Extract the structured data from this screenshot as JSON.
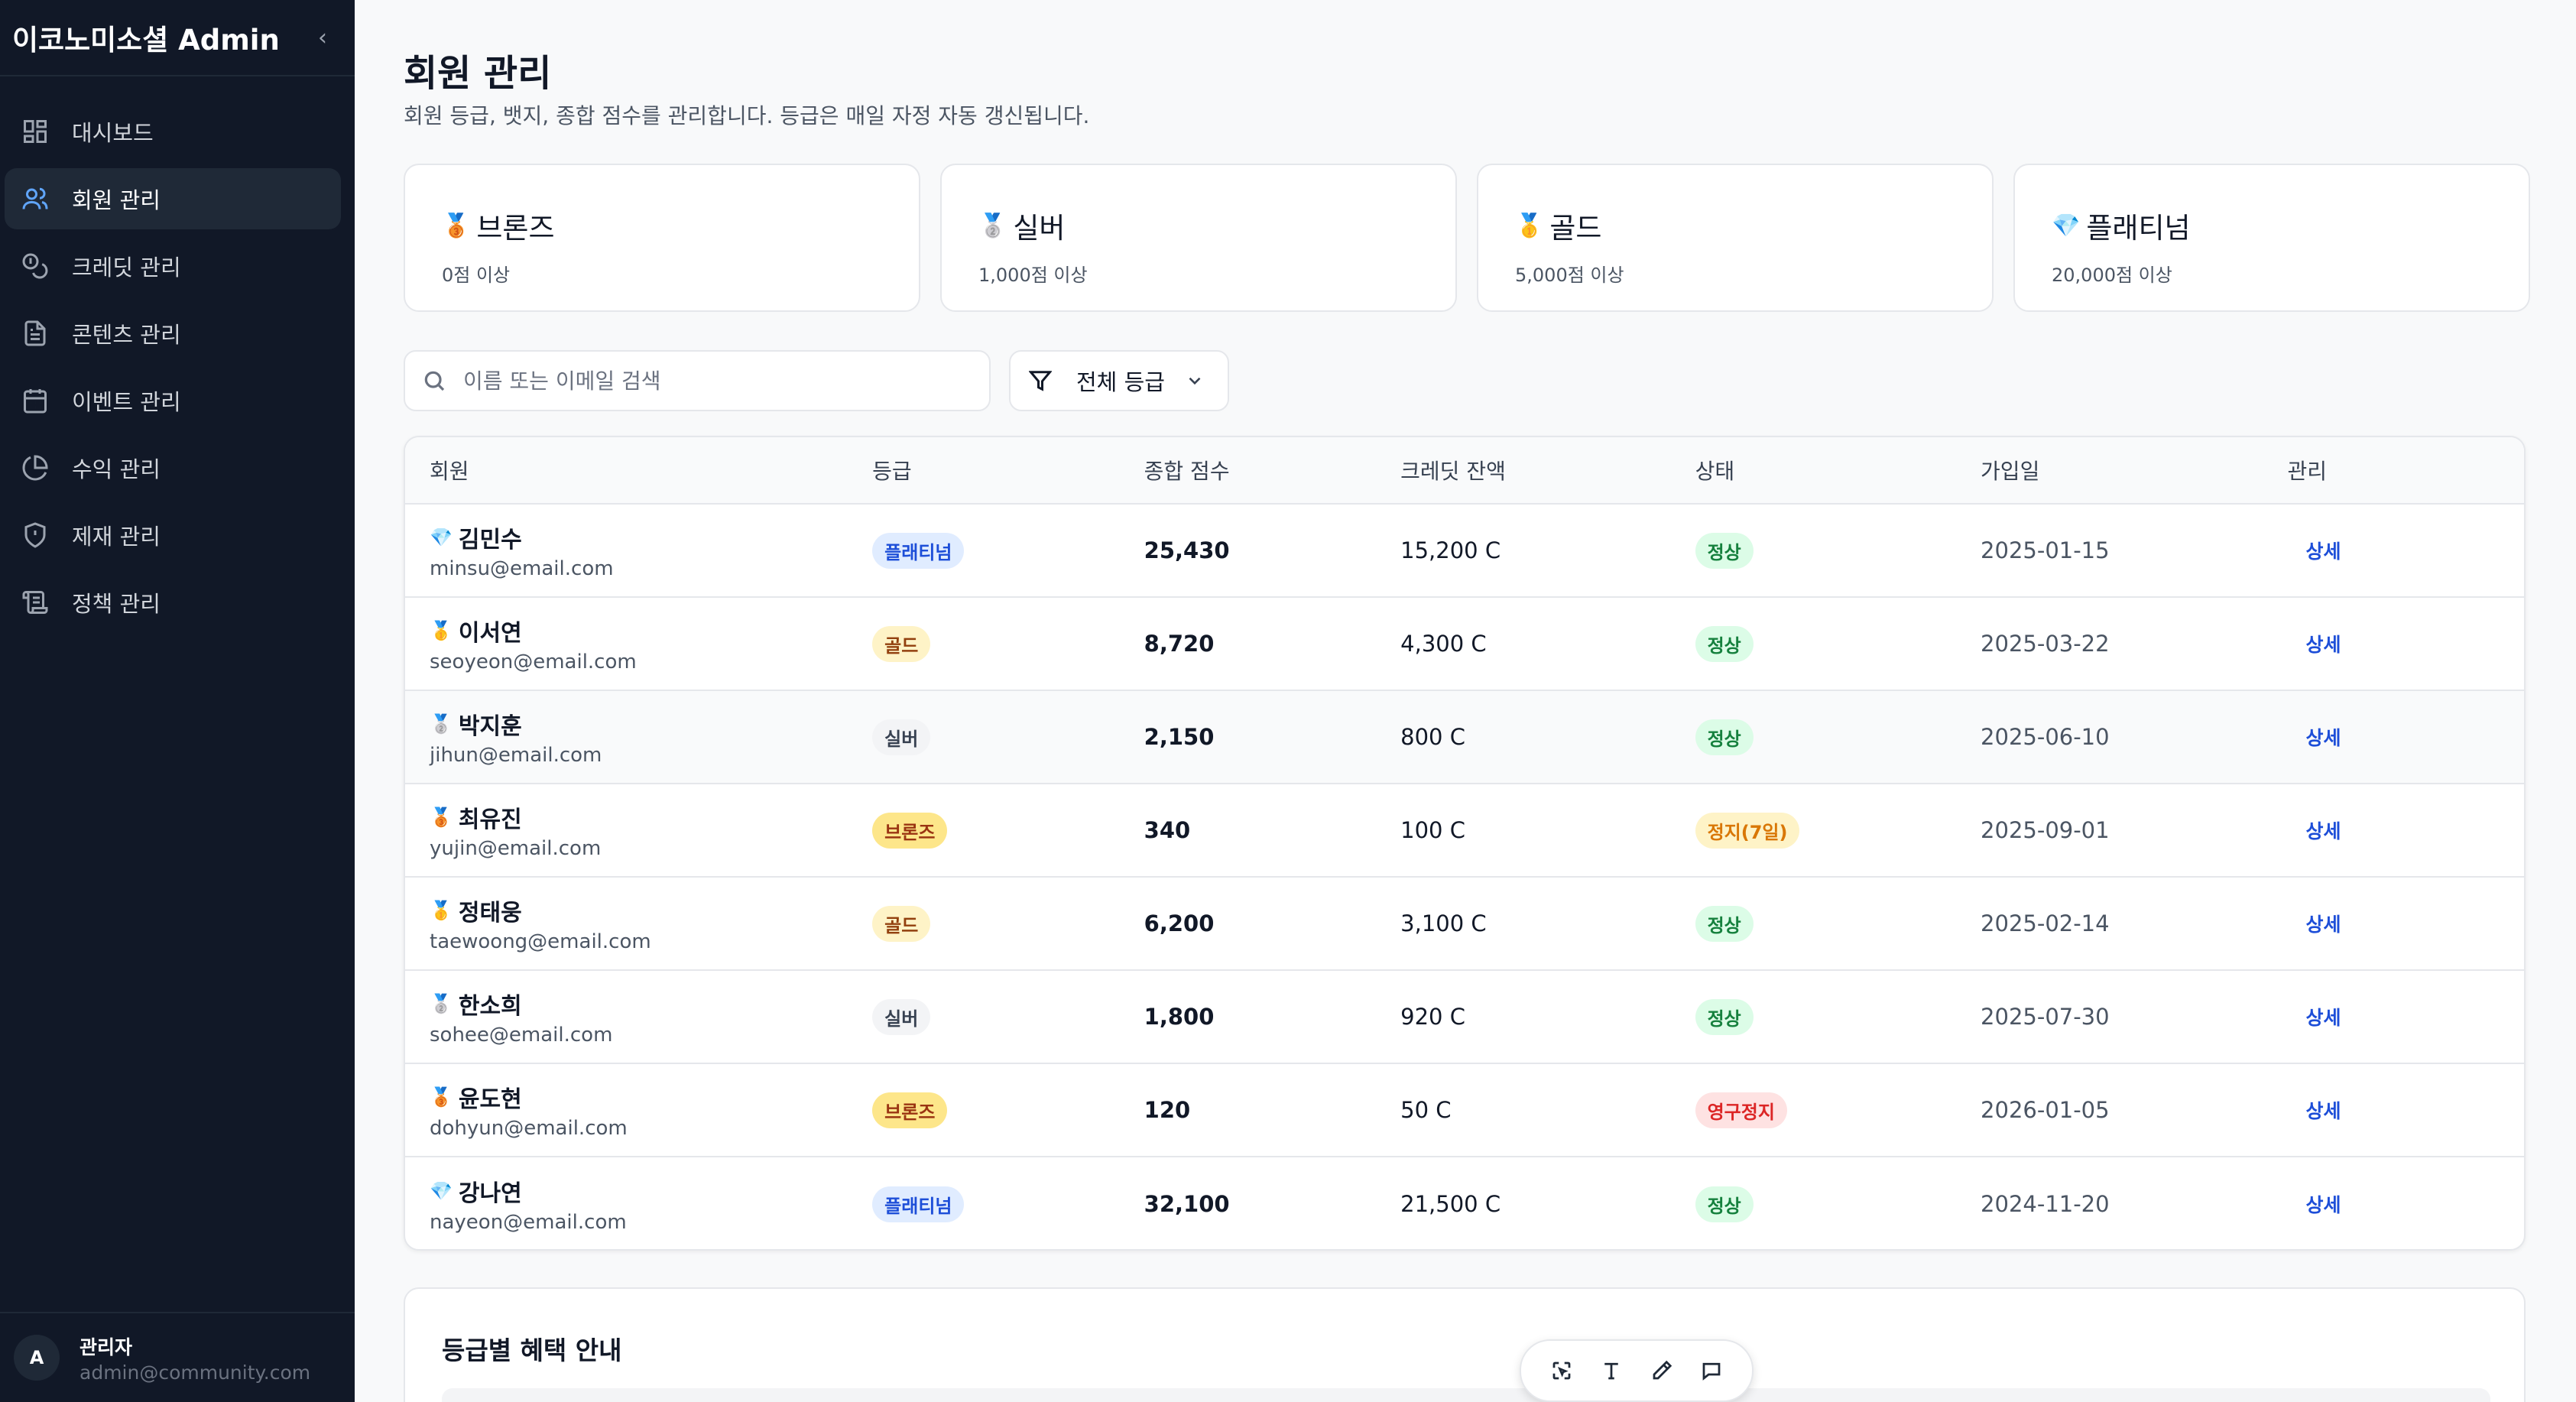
{
  "app": {
    "title": "이코노미소셜 Admin",
    "collapse_icon": "chevron-left-icon"
  },
  "sidebar": {
    "items": [
      {
        "label": "대시보드",
        "icon": "dashboard-icon"
      },
      {
        "label": "회원 관리",
        "icon": "users-icon",
        "active": true
      },
      {
        "label": "크레딧 관리",
        "icon": "coins-icon"
      },
      {
        "label": "콘텐츠 관리",
        "icon": "document-icon"
      },
      {
        "label": "이벤트 관리",
        "icon": "calendar-icon"
      },
      {
        "label": "수익 관리",
        "icon": "pie-chart-icon"
      },
      {
        "label": "제재 관리",
        "icon": "shield-icon"
      },
      {
        "label": "정책 관리",
        "icon": "scroll-icon"
      }
    ],
    "user": {
      "initial": "A",
      "name": "관리자",
      "email": "admin@community.com"
    }
  },
  "page": {
    "title": "회원 관리",
    "subtitle": "회원 등급, 뱃지, 종합 점수를 관리합니다. 등급은 매일 자정 자동 갱신됩니다."
  },
  "tiers": [
    {
      "medal": "🥉",
      "name": "브론즈",
      "min": "0점 이상"
    },
    {
      "medal": "🥈",
      "name": "실버",
      "min": "1,000점 이상"
    },
    {
      "medal": "🥇",
      "name": "골드",
      "min": "5,000점 이상"
    },
    {
      "medal": "💎",
      "name": "플래티넘",
      "min": "20,000점 이상"
    }
  ],
  "search": {
    "placeholder": "이름 또는 이메일 검색",
    "value": ""
  },
  "filter": {
    "label": "전체 등급"
  },
  "table": {
    "headers": [
      "회원",
      "등급",
      "종합 점수",
      "크레딧 잔액",
      "상태",
      "가입일",
      "관리"
    ],
    "rows": [
      {
        "medal": "💎",
        "name": "김민수",
        "email": "minsu@email.com",
        "grade": "플래티넘",
        "score": "25,430",
        "credit": "15,200 C",
        "status": "정상",
        "joined": "2025-01-15",
        "action": "상세"
      },
      {
        "medal": "🥇",
        "name": "이서연",
        "email": "seoyeon@email.com",
        "grade": "골드",
        "score": "8,720",
        "credit": "4,300 C",
        "status": "정상",
        "joined": "2025-03-22",
        "action": "상세"
      },
      {
        "medal": "🥈",
        "name": "박지훈",
        "email": "jihun@email.com",
        "grade": "실버",
        "score": "2,150",
        "credit": "800 C",
        "status": "정상",
        "joined": "2025-06-10",
        "action": "상세"
      },
      {
        "medal": "🥉",
        "name": "최유진",
        "email": "yujin@email.com",
        "grade": "브론즈",
        "score": "340",
        "credit": "100 C",
        "status": "정지(7일)",
        "joined": "2025-09-01",
        "action": "상세"
      },
      {
        "medal": "🥇",
        "name": "정태웅",
        "email": "taewoong@email.com",
        "grade": "골드",
        "score": "6,200",
        "credit": "3,100 C",
        "status": "정상",
        "joined": "2025-02-14",
        "action": "상세"
      },
      {
        "medal": "🥈",
        "name": "한소희",
        "email": "sohee@email.com",
        "grade": "실버",
        "score": "1,800",
        "credit": "920 C",
        "status": "정상",
        "joined": "2025-07-30",
        "action": "상세"
      },
      {
        "medal": "🥉",
        "name": "윤도현",
        "email": "dohyun@email.com",
        "grade": "브론즈",
        "score": "120",
        "credit": "50 C",
        "status": "영구정지",
        "joined": "2026-01-05",
        "action": "상세"
      },
      {
        "medal": "💎",
        "name": "강나연",
        "email": "nayeon@email.com",
        "grade": "플래티넘",
        "score": "32,100",
        "credit": "21,500 C",
        "status": "정상",
        "joined": "2024-11-20",
        "action": "상세"
      }
    ]
  },
  "grade_colors": {
    "플래티넘": {
      "bg": "#e0ecff",
      "fg": "#1d4ed8"
    },
    "골드": {
      "bg": "#fef3c7",
      "fg": "#92400e"
    },
    "실버": {
      "bg": "#f3f4f6",
      "fg": "#374151"
    },
    "브론즈": {
      "bg": "#fde68a",
      "fg": "#9a3412"
    }
  },
  "status_colors": {
    "정상": {
      "bg": "#dcfce7",
      "fg": "#15803d"
    },
    "정지(7일)": {
      "bg": "#fef3c7",
      "fg": "#d97706"
    },
    "영구정지": {
      "bg": "#fee2e2",
      "fg": "#dc2626"
    }
  },
  "benefits": {
    "title": "등급별 혜택 안내"
  },
  "toolbar": {
    "icons": [
      "select-icon",
      "text-icon",
      "pen-icon",
      "comment-icon"
    ]
  }
}
